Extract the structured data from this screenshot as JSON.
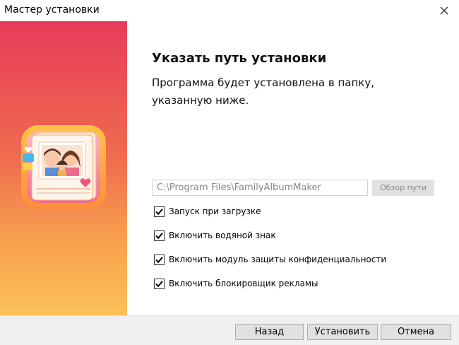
{
  "window": {
    "title": "Мастер установки"
  },
  "page": {
    "heading": "Указать путь установки",
    "subheading": "Программа будет установлена в папку, указанную ниже."
  },
  "install_path": {
    "value": "C:\\Program Files\\FamilyAlbumMaker",
    "browse_label": "Обзор пути"
  },
  "options": [
    {
      "label": "Запуск при загрузке",
      "checked": true
    },
    {
      "label": "Включить водяной знак",
      "checked": true
    },
    {
      "label": "Включить модуль защиты конфиденциальности",
      "checked": true
    },
    {
      "label": "Включить блокировщик рекламы",
      "checked": true
    }
  ],
  "buttons": {
    "back": "Назад",
    "install": "Установить",
    "cancel": "Отмена"
  },
  "colors": {
    "banner_top": "#e73c5a",
    "banner_bottom": "#fcc158",
    "accent_pink": "#f0567a"
  }
}
